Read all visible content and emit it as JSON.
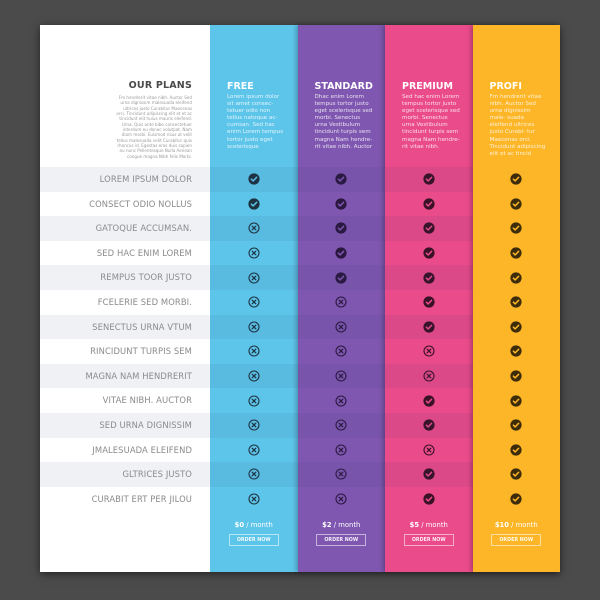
{
  "header": {
    "title": "OUR PLANS",
    "description": "Fm hendrerit vitae nibh. Auctor Sed urna dignissim malesuada eleifend ultrices justo Curabitur Maecenas orci. Tincidunt adipiscing elit et et ac tincidunt elit huius mauris eleifend. Urna. Quis ante bibe consectetuer interdum eu donec volutpat. Nam diam morbi. Euismod risus ut velit tellus malesuada velit Curabitur quis rhoncus id. Egestas eros duis sapien eu nunc Pellentesque Nulla Aenean congue magna Nibh felis Morbi."
  },
  "features": [
    "LOREM IPSUM DOLOR",
    "CONSECT ODIO NOLLUS",
    "GATOQUE ACCUMSAN.",
    "SED HAC ENIM LOREM",
    "REMPUS TOOR JUSTO",
    "FCELERIE SED MORBI.",
    "SENECTUS URNA VTUM",
    "RINCIDUNT TURPIS SEM",
    "MAGNA NAM HENDRERIT",
    "VITAE NIBH. AUCTOR",
    "SED URNA DIGNISSIM",
    "JMALESUADA ELEIFEND",
    "GLTRICES JUSTO",
    "CURABIT ERT PER JILOU"
  ],
  "plans": [
    {
      "name": "FREE",
      "color": "#5ec5ea",
      "icon_color": "#1d3340",
      "description": "Lorem ipsum dolor sit amet consec- tetuer odio non tellus natoque ac- cumsan. Sed hac enim Lorem tempus tortor justo eget scelerisque",
      "price": "$0",
      "period": " / month",
      "cta": "ORDER NOW",
      "included": [
        true,
        true,
        false,
        false,
        false,
        false,
        false,
        false,
        false,
        false,
        false,
        false,
        false,
        false
      ]
    },
    {
      "name": "STANDARD",
      "color": "#7f57b0",
      "icon_color": "#2a1840",
      "description": "Dhac enim Lorem tempus tortor justo eget scelerisque sed morbi. Senectus urna Vestibulum tincidunt turpis sem magna Nam hendre- rit vitae nibh. Auctor",
      "price": "$2",
      "period": " / month",
      "cta": "ORDER NOW",
      "included": [
        true,
        true,
        true,
        true,
        true,
        false,
        false,
        false,
        false,
        false,
        false,
        false,
        false,
        false
      ]
    },
    {
      "name": "PREMIUM",
      "color": "#ea4b8b",
      "icon_color": "#3a1226",
      "description": "Sed hac enim Lorem tempus tortor justo eget scelerisque sed morbi. Senectus urna Vestibulum tincidunt turpis sem magna Nam hendre- rit vitae nibh.",
      "price": "$5",
      "period": " / month",
      "cta": "ORDER NOW",
      "included": [
        true,
        true,
        true,
        true,
        true,
        true,
        true,
        false,
        false,
        true,
        true,
        false,
        true,
        true
      ]
    },
    {
      "name": "PROFI",
      "color": "#fdb627",
      "icon_color": "#3d2c0a",
      "description": "Fm hendrerit vitae nibh. Auctor Sed urna dignissim male- suada eleifend ultrices justo Curabi- tur Maecenas orci. Tincidunt adipiscing elit et ac tincid",
      "price": "$10",
      "period": " / month",
      "cta": "ORDER NOW",
      "included": [
        true,
        true,
        true,
        true,
        true,
        true,
        true,
        true,
        true,
        true,
        true,
        true,
        true,
        true
      ]
    }
  ],
  "icons": {
    "included": "check-circle-icon",
    "excluded": "x-circle-icon"
  }
}
